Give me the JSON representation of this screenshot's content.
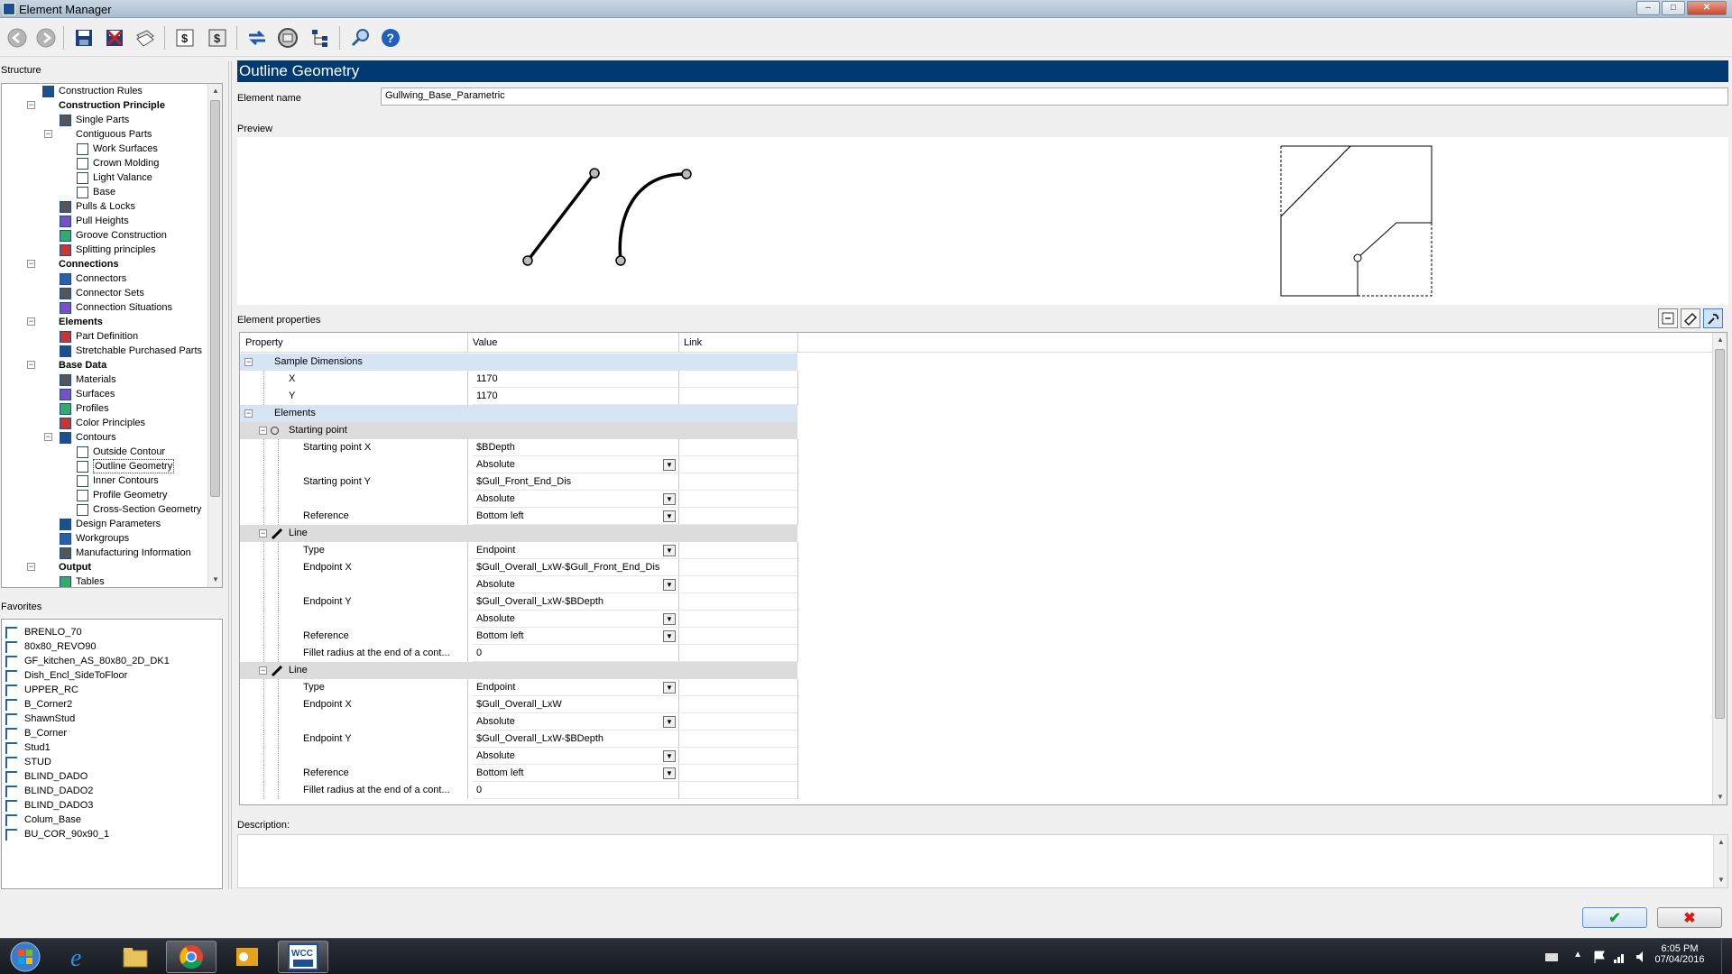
{
  "window": {
    "title": "Element Manager",
    "minimize": "–",
    "maximize": "□",
    "close": "✕"
  },
  "toolbar": {
    "buttons": [
      "back",
      "forward",
      "save",
      "delete",
      "copy",
      "import",
      "export",
      "transfer",
      "settings",
      "tree",
      "find",
      "help"
    ]
  },
  "structure": {
    "title": "Structure",
    "items": [
      {
        "label": "Construction Rules",
        "level": 1,
        "bold": false,
        "icon": "rules-icon"
      },
      {
        "label": "Construction Principle",
        "level": 1,
        "bold": true,
        "expander": "−"
      },
      {
        "label": "Single Parts",
        "level": 2,
        "bold": false,
        "icon": "parts-icon"
      },
      {
        "label": "Contiguous Parts",
        "level": 2,
        "bold": false,
        "expander": "−"
      },
      {
        "label": "Work Surfaces",
        "level": 3,
        "bold": false,
        "icon": "surface-icon"
      },
      {
        "label": "Crown Molding",
        "level": 3,
        "bold": false,
        "icon": "molding-icon"
      },
      {
        "label": "Light Valance",
        "level": 3,
        "bold": false,
        "icon": "valance-icon"
      },
      {
        "label": "Base",
        "level": 3,
        "bold": false,
        "icon": "base-icon"
      },
      {
        "label": "Pulls & Locks",
        "level": 2,
        "bold": false,
        "icon": "pull-icon"
      },
      {
        "label": "Pull Heights",
        "level": 2,
        "bold": false,
        "icon": "height-icon"
      },
      {
        "label": "Groove Construction",
        "level": 2,
        "bold": false,
        "icon": "groove-icon"
      },
      {
        "label": "Splitting principles",
        "level": 2,
        "bold": false,
        "icon": "split-icon"
      },
      {
        "label": "Connections",
        "level": 1,
        "bold": true,
        "expander": "−"
      },
      {
        "label": "Connectors",
        "level": 2,
        "bold": false,
        "icon": "connector-icon"
      },
      {
        "label": "Connector Sets",
        "level": 2,
        "bold": false,
        "icon": "connector-set-icon"
      },
      {
        "label": "Connection Situations",
        "level": 2,
        "bold": false,
        "icon": "situation-icon"
      },
      {
        "label": "Elements",
        "level": 1,
        "bold": true,
        "expander": "−"
      },
      {
        "label": "Part Definition",
        "level": 2,
        "bold": false,
        "icon": "part-def-icon"
      },
      {
        "label": "Stretchable Purchased Parts",
        "level": 2,
        "bold": false,
        "icon": "stretch-icon"
      },
      {
        "label": "Base Data",
        "level": 1,
        "bold": true,
        "expander": "−"
      },
      {
        "label": "Materials",
        "level": 2,
        "bold": false,
        "icon": "materials-icon"
      },
      {
        "label": "Surfaces",
        "level": 2,
        "bold": false,
        "icon": "surfaces-icon"
      },
      {
        "label": "Profiles",
        "level": 2,
        "bold": false,
        "icon": "profiles-icon"
      },
      {
        "label": "Color Principles",
        "level": 2,
        "bold": false,
        "icon": "color-icon"
      },
      {
        "label": "Contours",
        "level": 2,
        "bold": false,
        "icon": "contours-icon",
        "expander": "−"
      },
      {
        "label": "Outside Contour",
        "level": 3,
        "bold": false,
        "icon": "outside-contour-icon"
      },
      {
        "label": "Outline Geometry",
        "level": 3,
        "bold": false,
        "icon": "outline-icon",
        "selected": true
      },
      {
        "label": "Inner Contours",
        "level": 3,
        "bold": false,
        "icon": "inner-icon"
      },
      {
        "label": "Profile Geometry",
        "level": 3,
        "bold": false,
        "icon": "profile-geo-icon"
      },
      {
        "label": "Cross-Section Geometry",
        "level": 3,
        "bold": false,
        "icon": "cross-icon"
      },
      {
        "label": "Design Parameters",
        "level": 2,
        "bold": false,
        "icon": "design-icon"
      },
      {
        "label": "Workgroups",
        "level": 2,
        "bold": false,
        "icon": "workgroups-icon"
      },
      {
        "label": "Manufacturing Information",
        "level": 2,
        "bold": false,
        "icon": "info-icon"
      },
      {
        "label": "Output",
        "level": 1,
        "bold": true,
        "expander": "−"
      },
      {
        "label": "Tables",
        "level": 2,
        "bold": false,
        "icon": "tables-icon"
      }
    ]
  },
  "favorites": {
    "title": "Favorites",
    "items": [
      "BRENLO_70",
      "80x80_REVO90",
      "GF_kitchen_AS_80x80_2D_DK1",
      "Dish_Encl_SideToFloor",
      "UPPER_RC",
      "B_Corner2",
      "ShawnStud",
      "B_Corner",
      "Stud1",
      "STUD",
      "BLIND_DADO",
      "BLIND_DADO2",
      "BLIND_DADO3",
      "Colum_Base",
      "BU_COR_90x90_1"
    ]
  },
  "main": {
    "header": "Outline Geometry",
    "element_name_label": "Element name",
    "element_name_value": "Gullwing_Base_Parametric",
    "preview_label": "Preview",
    "properties_label": "Element properties",
    "description_label": "Description:"
  },
  "grid": {
    "headers": [
      "Property",
      "Value",
      "Link"
    ],
    "rows": [
      {
        "type": "cat",
        "indent": 0,
        "prop": "Sample Dimensions",
        "value": "",
        "toggle": "−"
      },
      {
        "type": "prop",
        "indent": 1,
        "prop": "X",
        "value": "1170"
      },
      {
        "type": "prop",
        "indent": 1,
        "prop": "Y",
        "value": "1170"
      },
      {
        "type": "cat",
        "indent": 0,
        "prop": "Elements",
        "value": "",
        "toggle": "−"
      },
      {
        "type": "sub",
        "indent": 1,
        "prop": "Starting point",
        "value": "",
        "toggle": "−",
        "icon": "point-icon"
      },
      {
        "type": "prop",
        "indent": 2,
        "prop": "Starting point X",
        "value": "$BDepth"
      },
      {
        "type": "prop",
        "indent": 2,
        "prop": "",
        "value": "Absolute",
        "dropdown": true
      },
      {
        "type": "prop",
        "indent": 2,
        "prop": "Starting point Y",
        "value": "$Gull_Front_End_Dis"
      },
      {
        "type": "prop",
        "indent": 2,
        "prop": "",
        "value": "Absolute",
        "dropdown": true
      },
      {
        "type": "prop",
        "indent": 2,
        "prop": "Reference",
        "value": "Bottom left",
        "dropdown": true
      },
      {
        "type": "sub",
        "indent": 1,
        "prop": "Line",
        "value": "",
        "toggle": "−",
        "icon": "line-icon"
      },
      {
        "type": "prop",
        "indent": 2,
        "prop": "Type",
        "value": "Endpoint",
        "dropdown": true
      },
      {
        "type": "prop",
        "indent": 2,
        "prop": "Endpoint X",
        "value": "$Gull_Overall_LxW-$Gull_Front_End_Dis"
      },
      {
        "type": "prop",
        "indent": 2,
        "prop": "",
        "value": "Absolute",
        "dropdown": true
      },
      {
        "type": "prop",
        "indent": 2,
        "prop": "Endpoint Y",
        "value": "$Gull_Overall_LxW-$BDepth"
      },
      {
        "type": "prop",
        "indent": 2,
        "prop": "",
        "value": "Absolute",
        "dropdown": true
      },
      {
        "type": "prop",
        "indent": 2,
        "prop": "Reference",
        "value": "Bottom left",
        "dropdown": true
      },
      {
        "type": "prop",
        "indent": 2,
        "prop": "Fillet radius at the end of a cont...",
        "value": "0"
      },
      {
        "type": "sub",
        "indent": 1,
        "prop": "Line",
        "value": "",
        "toggle": "−",
        "icon": "line-icon"
      },
      {
        "type": "prop",
        "indent": 2,
        "prop": "Type",
        "value": "Endpoint",
        "dropdown": true
      },
      {
        "type": "prop",
        "indent": 2,
        "prop": "Endpoint X",
        "value": "$Gull_Overall_LxW"
      },
      {
        "type": "prop",
        "indent": 2,
        "prop": "",
        "value": "Absolute",
        "dropdown": true
      },
      {
        "type": "prop",
        "indent": 2,
        "prop": "Endpoint Y",
        "value": "$Gull_Overall_LxW-$BDepth"
      },
      {
        "type": "prop",
        "indent": 2,
        "prop": "",
        "value": "Absolute",
        "dropdown": true
      },
      {
        "type": "prop",
        "indent": 2,
        "prop": "Reference",
        "value": "Bottom left",
        "dropdown": true
      },
      {
        "type": "prop",
        "indent": 2,
        "prop": "Fillet radius at the end of a cont...",
        "value": "0"
      }
    ]
  },
  "buttons": {
    "ok": "✔",
    "cancel": "✖"
  },
  "taskbar": {
    "apps": [
      "start",
      "internet-explorer",
      "file-explorer",
      "chrome",
      "outlook",
      "wcc"
    ],
    "time": "6:05 PM",
    "date": "07/04/2016"
  }
}
